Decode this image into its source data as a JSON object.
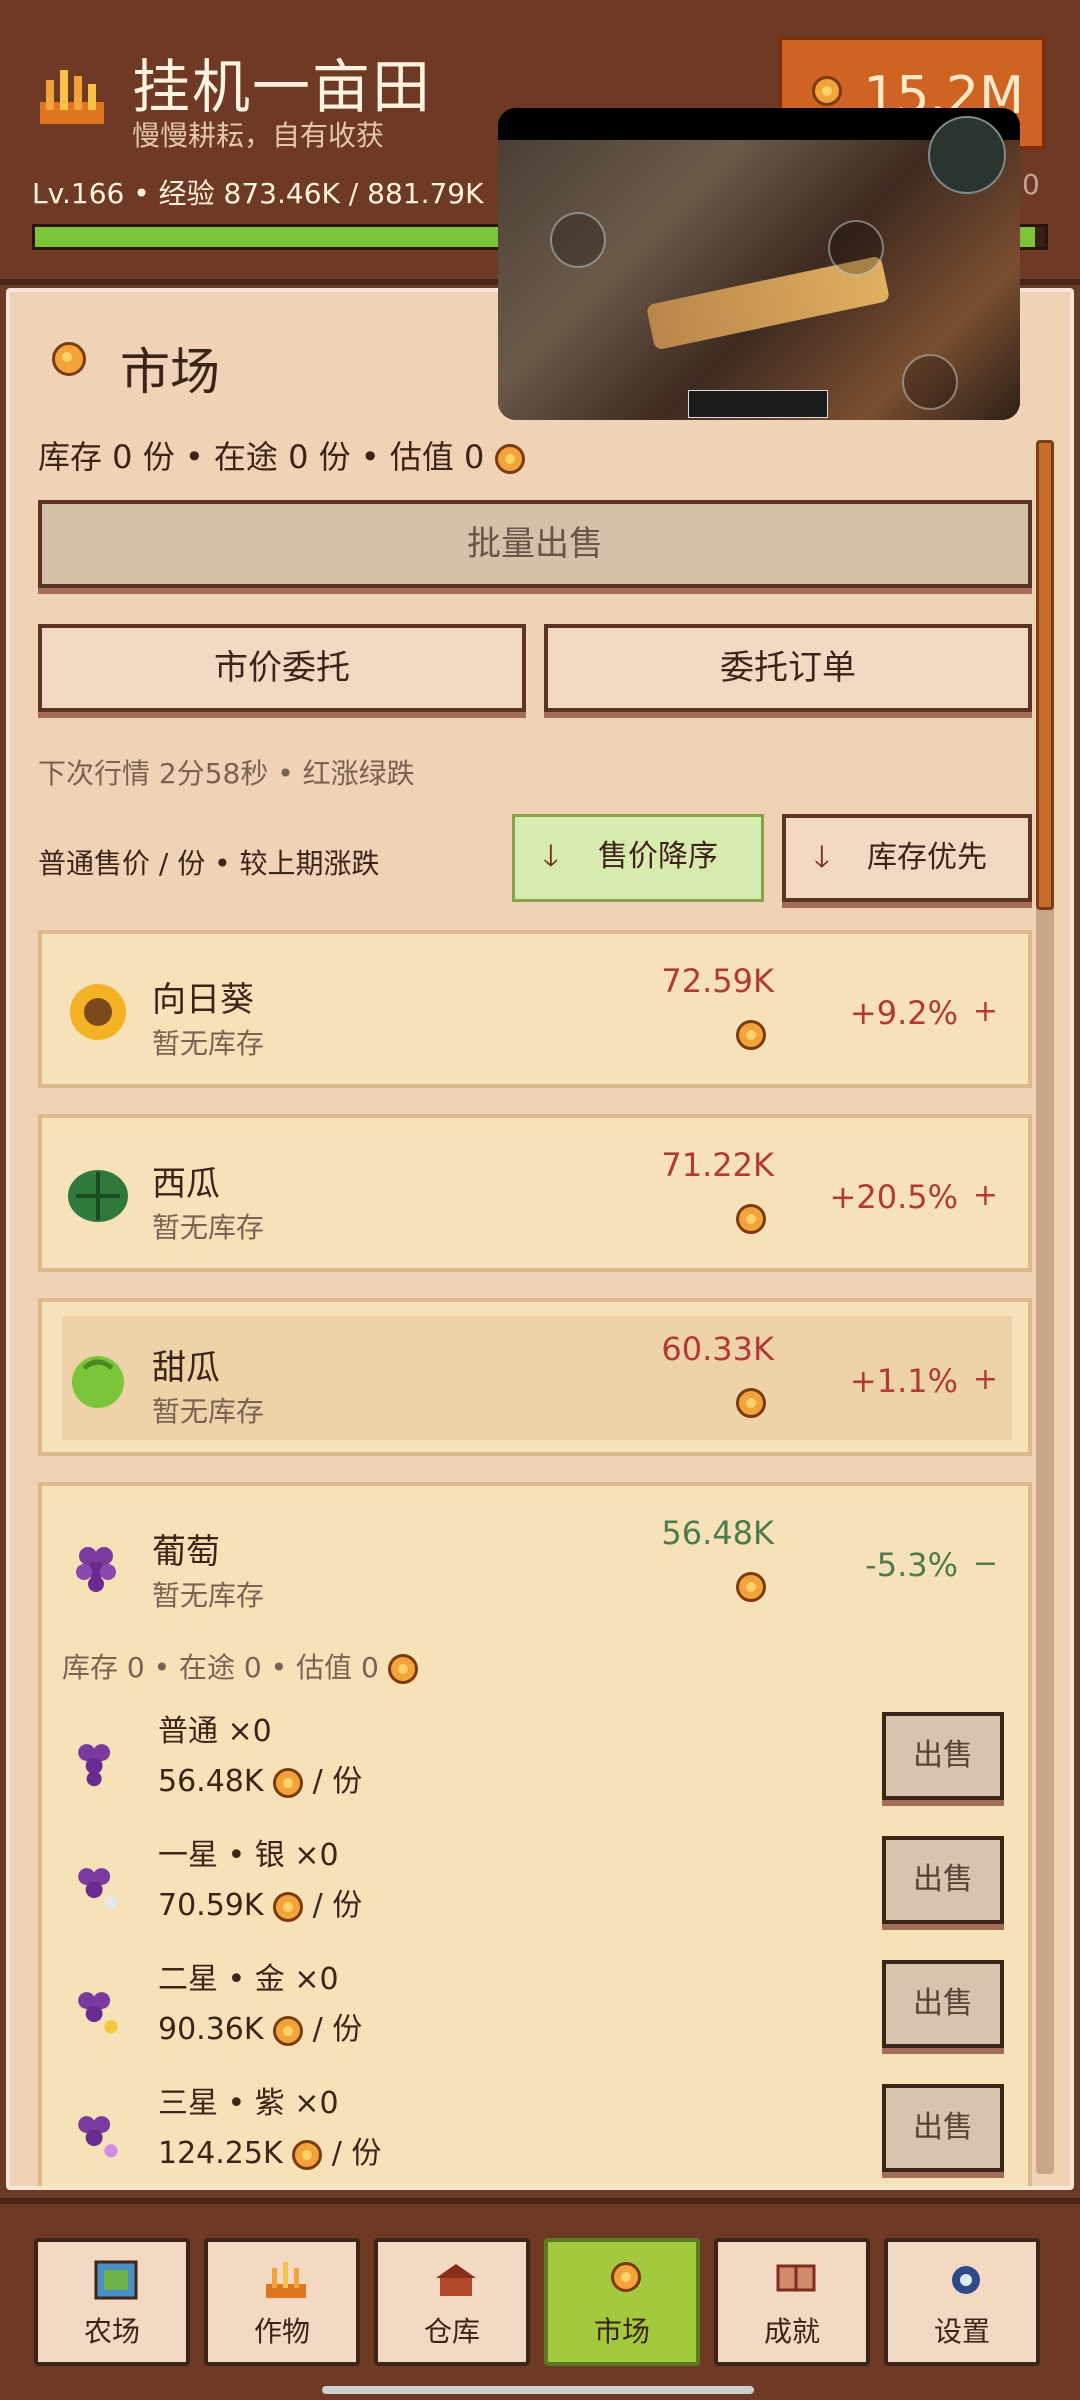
{
  "header": {
    "title": "挂机一亩田",
    "subtitle": "慢慢耕耘，自有收获",
    "level_line": "Lv.166 • 经验 873.46K / 881.79K",
    "coins": "15.2M",
    "xp_progress": 0.99
  },
  "market": {
    "title": "市场",
    "summary": "库存 0 份 • 在途 0 份 • 估值 0",
    "bulk_sell": "批量出售",
    "market_order": "市价委托",
    "order_list": "委托订单",
    "next_quote": "下次行情 2分58秒 • 红涨绿跌",
    "price_note": "普通售价 / 份 • 较上期涨跌",
    "sort_price": "售价降序",
    "sort_stock": "库存优先"
  },
  "items": [
    {
      "name": "向日葵",
      "stock": "暂无库存",
      "price": "72.59K",
      "change": "+9.2%",
      "sign": "+"
    },
    {
      "name": "西瓜",
      "stock": "暂无库存",
      "price": "71.22K",
      "change": "+20.5%",
      "sign": "+"
    },
    {
      "name": "甜瓜",
      "stock": "暂无库存",
      "price": "60.33K",
      "change": "+1.1%",
      "sign": "+"
    },
    {
      "name": "葡萄",
      "stock": "暂无库存",
      "price": "56.48K",
      "change": "-5.3%",
      "sign": "−"
    }
  ],
  "grape_detail": {
    "summary": "库存 0 • 在途 0 • 估值 0",
    "qualities": [
      {
        "label": "普通 ×0",
        "price": "56.48K",
        "unit": "/ 份",
        "sell": "出售"
      },
      {
        "label": "一星 • 银 ×0",
        "price": "70.59K",
        "unit": "/ 份",
        "sell": "出售"
      },
      {
        "label": "二星 • 金 ×0",
        "price": "90.36K",
        "unit": "/ 份",
        "sell": "出售"
      },
      {
        "label": "三星 • 紫 ×0",
        "price": "124.25K",
        "unit": "/ 份",
        "sell": "出售"
      }
    ]
  },
  "nav": [
    {
      "label": "农场",
      "icon": "farm-icon"
    },
    {
      "label": "作物",
      "icon": "crops-icon"
    },
    {
      "label": "仓库",
      "icon": "warehouse-icon"
    },
    {
      "label": "市场",
      "icon": "market-icon"
    },
    {
      "label": "成就",
      "icon": "achievement-icon"
    },
    {
      "label": "设置",
      "icon": "settings-icon"
    }
  ]
}
